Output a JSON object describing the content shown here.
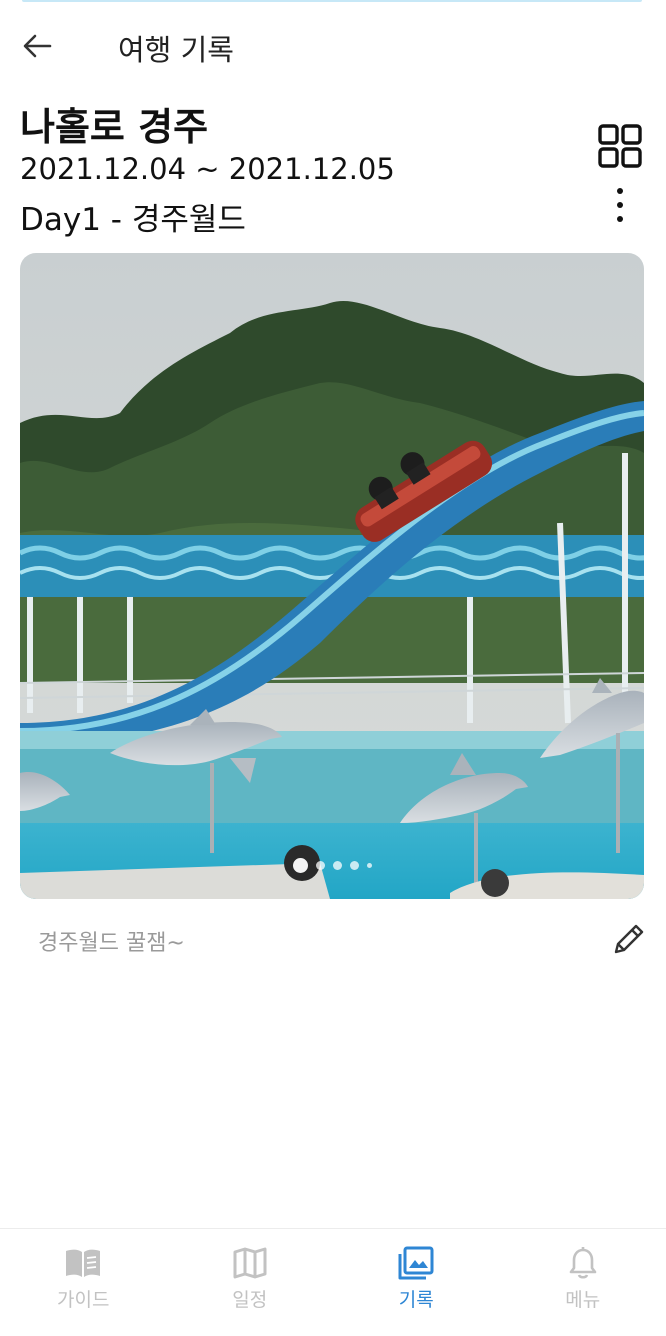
{
  "appbar": {
    "title": "여행 기록"
  },
  "trip": {
    "title": "나홀로 경주",
    "dates": "2021.12.04 ~ 2021.12.05",
    "day": "Day1 - 경주월드"
  },
  "photo": {
    "description_icon": "photo",
    "carousel": {
      "total": 5,
      "active_index": 0
    }
  },
  "caption": {
    "text": "경주월드 꿀잼~"
  },
  "bottom_nav": {
    "items": [
      {
        "label": "가이드",
        "icon": "book-icon",
        "active": false
      },
      {
        "label": "일정",
        "icon": "map-icon",
        "active": false
      },
      {
        "label": "기록",
        "icon": "gallery-icon",
        "active": true
      },
      {
        "label": "메뉴",
        "icon": "bell-icon",
        "active": false
      }
    ]
  },
  "colors": {
    "accent": "#2e86d4",
    "inactive": "#c2c2c2",
    "caption": "#9a9a9a"
  }
}
